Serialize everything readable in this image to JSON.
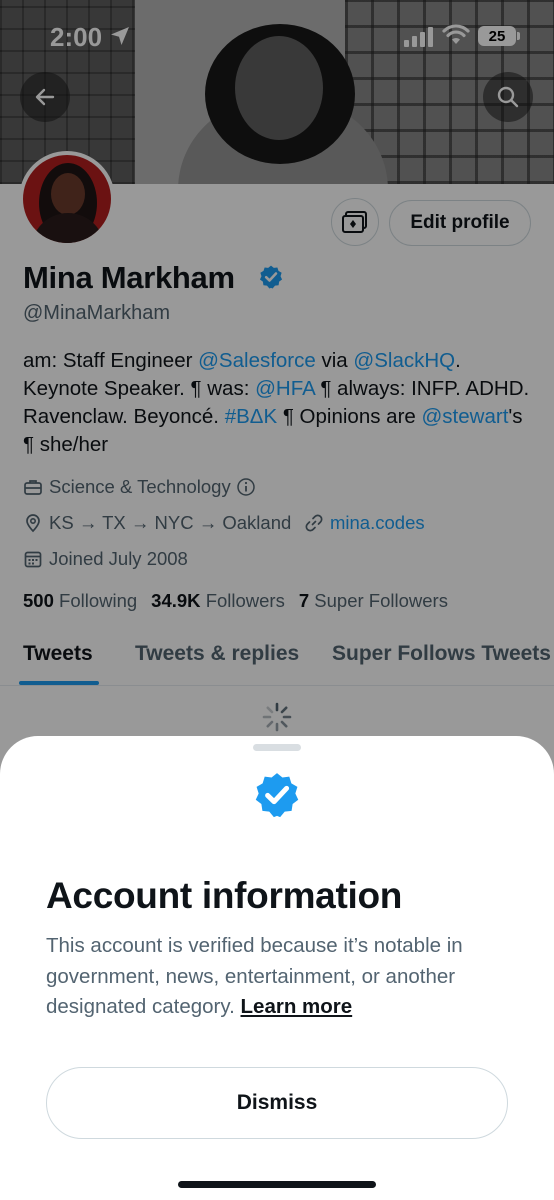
{
  "status_bar": {
    "time": "2:00",
    "battery": "25"
  },
  "profile": {
    "display_name": "Mina Markham",
    "handle": "@MinaMarkham",
    "edit_profile_label": "Edit profile",
    "bio": {
      "t1": "am: Staff Engineer ",
      "l1": "@Salesforce",
      "t2": " via ",
      "l2": "@SlackHQ",
      "t3": ". Keynote Speaker. ¶ was: ",
      "l3": "@HFA",
      "t4": " ¶ always: INFP. ADHD. Ravenclaw. Beyoncé. ",
      "l4": "#BΔK",
      "t5": " ¶ Opinions are ",
      "l5": "@stewart",
      "t6": "'s ¶ she/her"
    },
    "category": "Science & Technology",
    "location": "KS → TX → NYC → Oakland",
    "website": "mina.codes",
    "joined": "Joined July 2008",
    "stats": {
      "following_count": "500",
      "following_label": "Following",
      "followers_count": "34.9K",
      "followers_label": "Followers",
      "super_count": "7",
      "super_label": "Super Followers"
    },
    "tabs": [
      "Tweets",
      "Tweets & replies",
      "Super Follows Tweets"
    ],
    "active_tab": 0
  },
  "sheet": {
    "title": "Account information",
    "description": "This account is verified because it’s notable in government, news, entertainment, or another designated category.",
    "learn_more": "Learn more",
    "dismiss": "Dismiss"
  },
  "colors": {
    "accent": "#1d9bf0",
    "text": "#0f1419",
    "muted": "#536471"
  },
  "icons": [
    "back-arrow-icon",
    "search-icon",
    "location-arrow-icon",
    "signal-icon",
    "wifi-icon",
    "battery-icon",
    "verified-badge-icon",
    "briefcase-icon",
    "info-icon",
    "location-pin-icon",
    "link-icon",
    "calendar-icon",
    "spinner-icon",
    "nft-avatar-icon"
  ]
}
